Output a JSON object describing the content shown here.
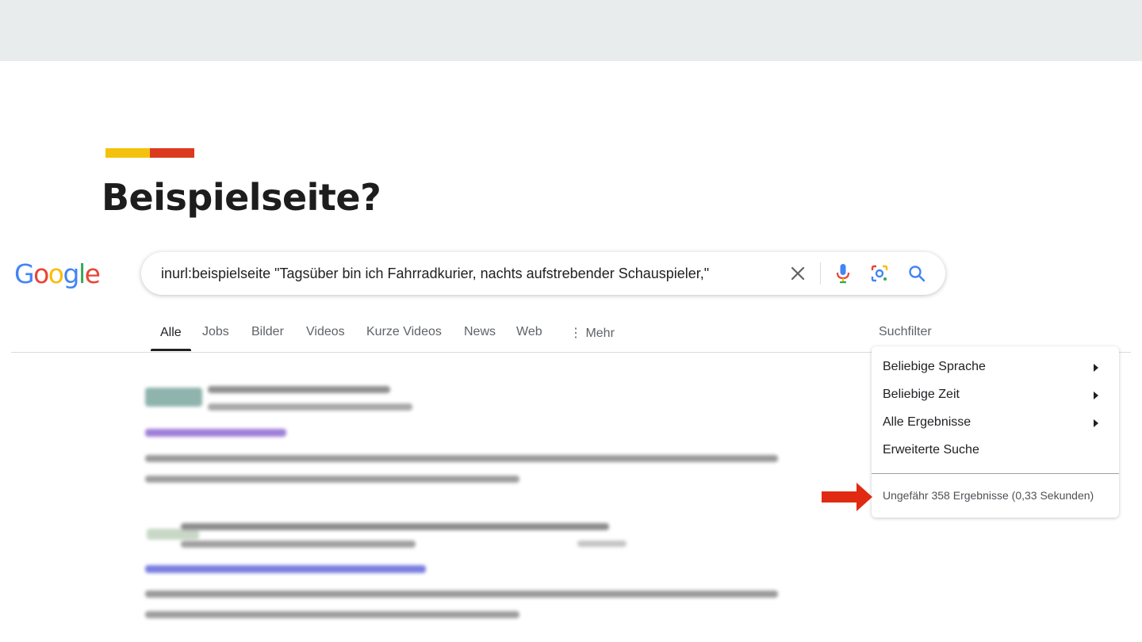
{
  "slide": {
    "title": "Beispielseite?",
    "accent_colors": [
      "#f4c20d",
      "#db3a1f"
    ]
  },
  "google": {
    "logo_letters": [
      {
        "char": "G",
        "color": "#4285f4"
      },
      {
        "char": "o",
        "color": "#ea4335"
      },
      {
        "char": "o",
        "color": "#fbbc05"
      },
      {
        "char": "g",
        "color": "#4285f4"
      },
      {
        "char": "l",
        "color": "#34a853"
      },
      {
        "char": "e",
        "color": "#ea4335"
      }
    ]
  },
  "search": {
    "query": "inurl:beispielseite \"Tagsüber bin ich Fahrradkurier, nachts aufstrebender Schauspieler,\"",
    "icons": [
      "close-icon",
      "microphone-icon",
      "lens-icon",
      "search-icon"
    ]
  },
  "tabs": {
    "items": [
      "Alle",
      "Jobs",
      "Bilder",
      "Videos",
      "Kurze Videos",
      "News",
      "Web",
      "⋮ Mehr"
    ],
    "active": "Alle",
    "tools_label": "Suchfilter"
  },
  "filter_menu": {
    "items": [
      {
        "label": "Beliebige Sprache",
        "has_submenu": true
      },
      {
        "label": "Beliebige Zeit",
        "has_submenu": true
      },
      {
        "label": "Alle Ergebnisse",
        "has_submenu": true
      },
      {
        "label": "Erweiterte Suche",
        "has_submenu": false
      }
    ],
    "result_stats": "Ungefähr 358 Ergebnisse (0,33 Sekunden)"
  },
  "annotation": {
    "arrow_color": "#e02b12"
  }
}
